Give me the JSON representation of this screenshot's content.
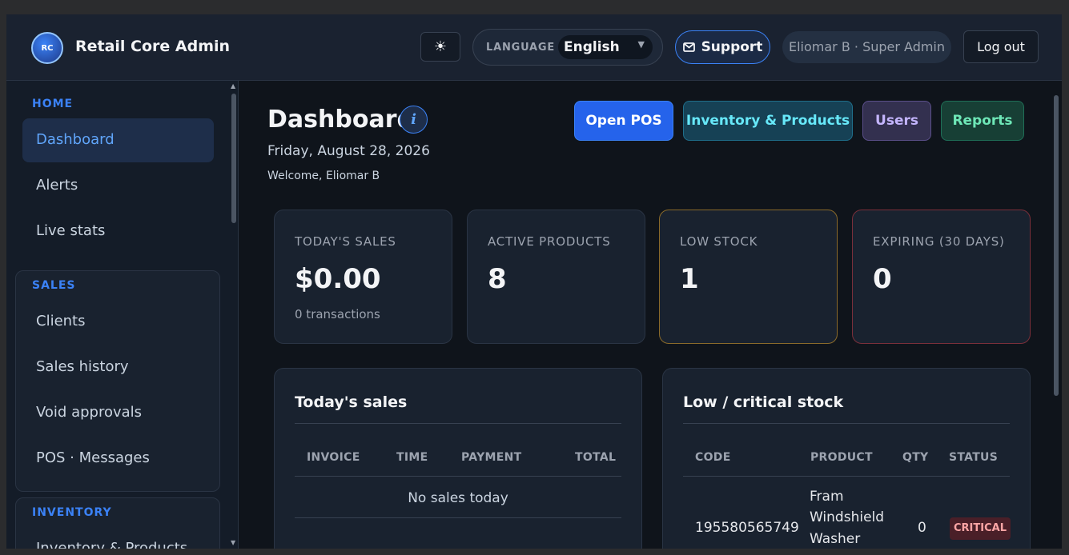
{
  "app": {
    "title": "Retail Core Admin",
    "logo_text": "RC"
  },
  "topbar": {
    "theme_icon": "sun-icon",
    "language_label": "LANGUAGE",
    "language_value": "English",
    "support_label": "Support",
    "user_label": "Eliomar B · Super Admin",
    "logout_label": "Log out"
  },
  "sidebar": {
    "sections": [
      {
        "title": "HOME",
        "items": [
          "Dashboard",
          "Alerts",
          "Live stats"
        ]
      },
      {
        "title": "SALES",
        "items": [
          "Clients",
          "Sales history",
          "Void approvals",
          "POS · Messages"
        ]
      },
      {
        "title": "INVENTORY",
        "items": [
          "Inventory & Products"
        ]
      }
    ],
    "active_item": "Dashboard"
  },
  "page": {
    "title": "Dashboard",
    "date": "Friday, August 28, 2026",
    "welcome": "Welcome, Eliomar B",
    "info_glyph": "i"
  },
  "quick_actions": {
    "open_pos": "Open POS",
    "inventory": "Inventory & Products",
    "users": "Users",
    "reports": "Reports"
  },
  "stats": [
    {
      "label": "TODAY'S SALES",
      "value": "$0.00",
      "sub": "0 transactions"
    },
    {
      "label": "ACTIVE PRODUCTS",
      "value": "8",
      "sub": ""
    },
    {
      "label": "LOW STOCK",
      "value": "1",
      "sub": ""
    },
    {
      "label": "EXPIRING (30 DAYS)",
      "value": "0",
      "sub": ""
    }
  ],
  "todays_sales": {
    "title": "Today's sales",
    "columns": [
      "INVOICE",
      "TIME",
      "PAYMENT",
      "TOTAL"
    ],
    "empty_text": "No sales today"
  },
  "low_stock": {
    "title": "Low / critical stock",
    "columns": [
      "CODE",
      "PRODUCT",
      "QTY",
      "STATUS"
    ],
    "rows": [
      {
        "code": "195580565749",
        "product_lines": [
          "Fram",
          "Windshield",
          "Washer"
        ],
        "qty": "0",
        "status": "CRITICAL"
      }
    ]
  },
  "colors": {
    "accent": "#3b82f6",
    "critical": "#fca5a5",
    "warning_border": "#8a6a2a",
    "danger_border": "#7a2f3a"
  }
}
